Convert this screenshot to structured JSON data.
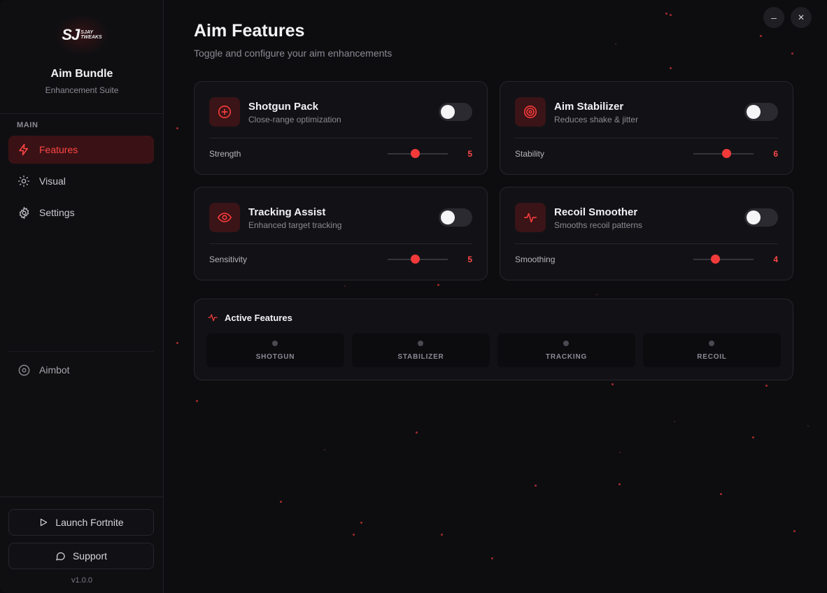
{
  "brand": {
    "logo_mark": "SJ",
    "logo_sub_1": "SJAY",
    "logo_sub_2": "TWEAKS",
    "title": "Aim Bundle",
    "subtitle": "Enhancement Suite"
  },
  "sidebar": {
    "section_label": "MAIN",
    "items": [
      {
        "label": "Features",
        "icon": "bolt-icon",
        "active": true
      },
      {
        "label": "Visual",
        "icon": "sun-icon",
        "active": false
      },
      {
        "label": "Settings",
        "icon": "gear-icon",
        "active": false
      }
    ],
    "extra_item": {
      "label": "Aimbot",
      "icon": "crosshair-icon"
    },
    "launch_button": "Launch Fortnite",
    "support_button": "Support",
    "version": "v1.0.0"
  },
  "header": {
    "title": "Aim Features",
    "subtitle": "Toggle and configure your aim enhancements"
  },
  "window_controls": {
    "minimize": "–",
    "close": "✕"
  },
  "features": [
    {
      "title": "Shotgun Pack",
      "desc": "Close-range optimization",
      "icon": "plus-circle-icon",
      "enabled": false,
      "slider_label": "Strength",
      "value": "5",
      "level": 0.45
    },
    {
      "title": "Aim Stabilizer",
      "desc": "Reduces shake & jitter",
      "icon": "target-icon",
      "enabled": false,
      "slider_label": "Stability",
      "value": "6",
      "level": 0.55
    },
    {
      "title": "Tracking Assist",
      "desc": "Enhanced target tracking",
      "icon": "eye-icon",
      "enabled": false,
      "slider_label": "Sensitivity",
      "value": "5",
      "level": 0.45
    },
    {
      "title": "Recoil Smoother",
      "desc": "Smooths recoil patterns",
      "icon": "pulse-icon",
      "enabled": false,
      "slider_label": "Smoothing",
      "value": "4",
      "level": 0.36
    }
  ],
  "active_panel": {
    "title": "Active Features",
    "tiles": [
      "SHOTGUN",
      "STABILIZER",
      "TRACKING",
      "RECOIL"
    ]
  },
  "colors": {
    "accent": "#f23a3a",
    "bg": "#0d0d10",
    "card": "#121216",
    "active_nav_bg": "#3a1215"
  }
}
